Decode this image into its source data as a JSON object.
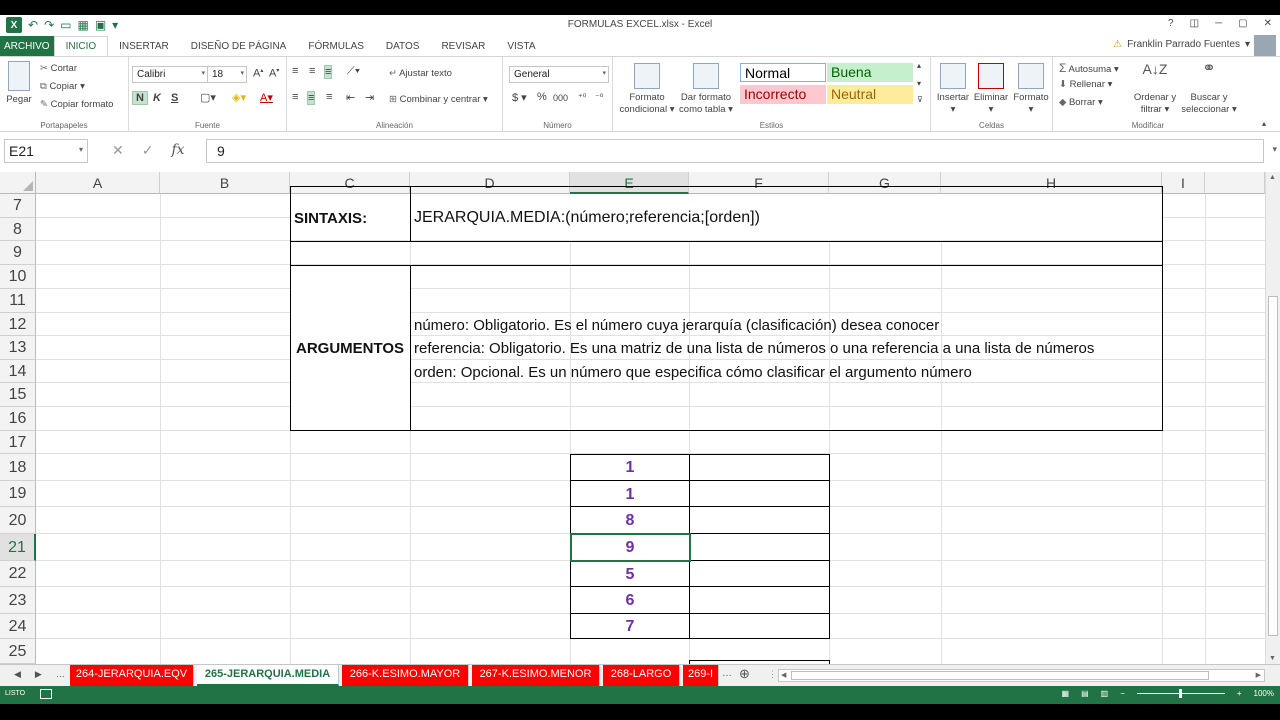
{
  "window": {
    "title": "FORMULAS EXCEL.xlsx - Excel",
    "controls": [
      "?",
      "◫",
      "─",
      "▢",
      "✕"
    ]
  },
  "ribbon_tabs": [
    "ARCHIVO",
    "INICIO",
    "INSERTAR",
    "DISEÑO DE PÁGINA",
    "FÓRMULAS",
    "DATOS",
    "REVISAR",
    "VISTA"
  ],
  "user": {
    "name": "Franklin Parrado Fuentes"
  },
  "clipboard": {
    "paste": "Pegar",
    "cut": "Cortar",
    "copy": "Copiar",
    "format_painter": "Copiar formato",
    "label": "Portapapeles"
  },
  "font": {
    "family": "Calibri",
    "size": "18",
    "bold": "N",
    "italic": "K",
    "underline": "S",
    "label": "Fuente"
  },
  "alignment": {
    "wrap": "Ajustar texto",
    "merge": "Combinar y centrar",
    "label": "Alineación"
  },
  "number": {
    "format": "General",
    "currency": "$",
    "percent": "%",
    "thousands": "000",
    "label": "Número"
  },
  "styles": {
    "conditional": [
      "Formato",
      "condicional"
    ],
    "as_table": [
      "Dar formato",
      "como tabla"
    ],
    "normal": "Normal",
    "buena": "Buena",
    "incorrecto": "Incorrecto",
    "neutral": "Neutral",
    "label": "Estilos"
  },
  "cells_group": {
    "insert": "Insertar",
    "delete": "Eliminar",
    "format": "Formato",
    "label": "Celdas"
  },
  "editing": {
    "autosum": "Autosuma",
    "fill": "Rellenar",
    "clear": "Borrar",
    "sort": [
      "Ordenar y",
      "filtrar"
    ],
    "find": [
      "Buscar y",
      "seleccionar"
    ],
    "label": "Modificar"
  },
  "formula_bar": {
    "name_box": "E21",
    "value": "9"
  },
  "columns": [
    "A",
    "B",
    "C",
    "D",
    "E",
    "F",
    "G",
    "H",
    "I"
  ],
  "rows": [
    "7",
    "8",
    "9",
    "10",
    "11",
    "12",
    "13",
    "14",
    "15",
    "16",
    "17",
    "18",
    "19",
    "20",
    "21",
    "22",
    "23",
    "24",
    "25"
  ],
  "sheet": {
    "sintaxis_label": "SINTAXIS:",
    "sintaxis_value": "JERARQUIA.MEDIA:(número;referencia;[orden])",
    "argumentos_label": "ARGUMENTOS",
    "arg_lines": [
      "número: Obligatorio. Es el número cuya jerarquía (clasificación) desea conocer",
      "referencia: Obligatorio. Es una matriz de una lista de números o una referencia a una lista de números",
      "orden: Opcional. Es un número que especifica cómo clasificar el argumento número"
    ],
    "numbers": [
      "1",
      "1",
      "8",
      "9",
      "5",
      "6",
      "7"
    ]
  },
  "sheet_tabs": [
    "264-JERARQUIA.EQV",
    "265-JERARQUIA.MEDIA",
    "266-K.ESIMO.MAYOR",
    "267-K.ESIMO.MENOR",
    "268-LARGO",
    "269-I"
  ],
  "active_sheet_tab": "265-JERARQUIA.MEDIA",
  "status": {
    "mode": "LISTO",
    "zoom": "100%"
  },
  "colors": {
    "excel_green": "#217346",
    "tab_red": "#ff0000",
    "number_purple": "#7030a0"
  }
}
